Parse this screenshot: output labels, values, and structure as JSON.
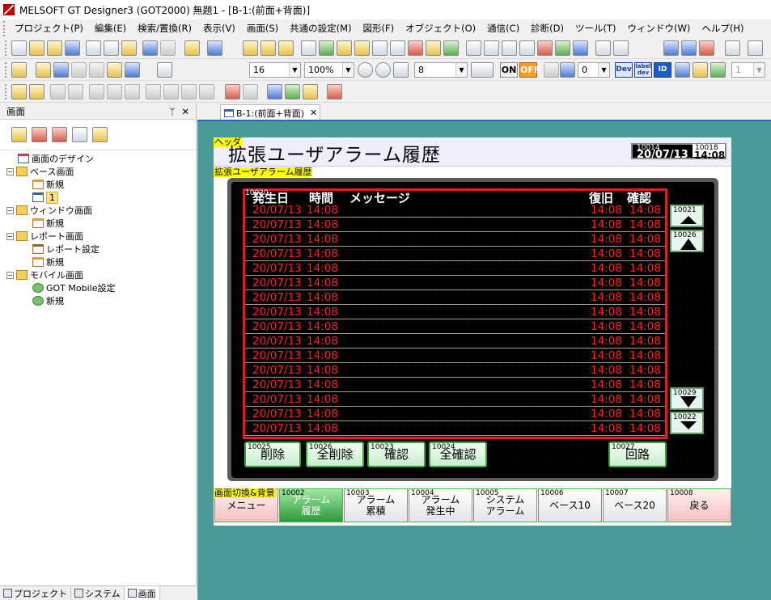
{
  "window": {
    "title": "MELSOFT GT Designer3 (GOT2000) 無題1 - [B-1:(前面+背面)]"
  },
  "menu": [
    "プロジェクト(P)",
    "編集(E)",
    "検索/置換(R)",
    "表示(V)",
    "画面(S)",
    "共通の設定(M)",
    "図形(F)",
    "オブジェクト(O)",
    "通信(C)",
    "診断(D)",
    "ツール(T)",
    "ウィンドウ(W)",
    "ヘルプ(H)"
  ],
  "toolbar": {
    "font_size": "16",
    "zoom": "100%",
    "grid": "8",
    "on_label": "ON",
    "off_label": "OFF",
    "step": "0",
    "dev_label": "Dev",
    "label_dev": "label dev",
    "id_label": "ID",
    "layer": "1"
  },
  "left_panel": {
    "title": "画面",
    "pin": "ꟷ",
    "close": "✕",
    "tree": [
      {
        "label": "画面のデザイン",
        "level": 1,
        "icon": "design-icon"
      },
      {
        "label": "ベース画面",
        "level": 0,
        "icon": "folder-icon"
      },
      {
        "label": "新規",
        "level": 1,
        "icon": "new-screen-icon"
      },
      {
        "label": "1",
        "level": 1,
        "icon": "screen-icon",
        "selected": true
      },
      {
        "label": "ウィンドウ画面",
        "level": 0,
        "icon": "folder-icon"
      },
      {
        "label": "新規",
        "level": 1,
        "icon": "new-screen-icon"
      },
      {
        "label": "レポート画面",
        "level": 0,
        "icon": "folder-icon"
      },
      {
        "label": "レポート設定",
        "level": 1,
        "icon": "report-settings-icon"
      },
      {
        "label": "新規",
        "level": 1,
        "icon": "new-screen-icon"
      },
      {
        "label": "モバイル画面",
        "level": 0,
        "icon": "folder-icon"
      },
      {
        "label": "GOT Mobile設定",
        "level": 1,
        "icon": "mobile-settings-icon"
      },
      {
        "label": "新規",
        "level": 1,
        "icon": "new-screen-icon"
      }
    ]
  },
  "bottom_tabs": [
    "プロジェクト",
    "システム",
    "画面"
  ],
  "doc_tab": {
    "label": "B-1:(前面+背面)",
    "close": "✕"
  },
  "screen": {
    "header_tag": "ヘッダ",
    "title": "拡張ユーザアラーム履歴",
    "alarm_tag": "拡張ユーザアラーム履歴",
    "nav_tag": "画面切換&背景",
    "clock": {
      "dev1": "10014",
      "date": "20/07/13",
      "dev2": "10018",
      "time": "14:08"
    },
    "alarm": {
      "dev": "10020",
      "columns": [
        "発生日",
        "時間",
        "メッセージ",
        "復旧",
        "確認"
      ],
      "rows": [
        [
          "20/07/13",
          "14:08",
          "14:08",
          "14:08"
        ],
        [
          "20/07/13",
          "14:08",
          "14:08",
          "14:08"
        ],
        [
          "20/07/13",
          "14:08",
          "14:08",
          "14:08"
        ],
        [
          "20/07/13",
          "14:08",
          "14:08",
          "14:08"
        ],
        [
          "20/07/13",
          "14:08",
          "14:08",
          "14:08"
        ],
        [
          "20/07/13",
          "14:08",
          "14:08",
          "14:08"
        ],
        [
          "20/07/13",
          "14:08",
          "14:08",
          "14:08"
        ],
        [
          "20/07/13",
          "14:08",
          "14:08",
          "14:08"
        ],
        [
          "20/07/13",
          "14:08",
          "14:08",
          "14:08"
        ],
        [
          "20/07/13",
          "14:08",
          "14:08",
          "14:08"
        ],
        [
          "20/07/13",
          "14:08",
          "14:08",
          "14:08"
        ],
        [
          "20/07/13",
          "14:08",
          "14:08",
          "14:08"
        ],
        [
          "20/07/13",
          "14:08",
          "14:08",
          "14:08"
        ],
        [
          "20/07/13",
          "14:08",
          "14:08",
          "14:08"
        ],
        [
          "20/07/13",
          "14:08",
          "14:08",
          "14:08"
        ],
        [
          "20/07/13",
          "14:08",
          "14:08",
          "14:08"
        ]
      ]
    },
    "side": [
      {
        "dev": "10021",
        "icon": "scroll-top-icon"
      },
      {
        "dev": "10026",
        "icon": "scroll-up-icon"
      },
      {
        "dev": "10029",
        "icon": "scroll-down-icon"
      },
      {
        "dev": "10022",
        "icon": "scroll-bottom-icon"
      }
    ],
    "buttons": [
      {
        "dev": "10025",
        "label": "削除"
      },
      {
        "dev": "10026",
        "label": "全削除"
      },
      {
        "dev": "10023",
        "label": "確認"
      },
      {
        "dev": "10024",
        "label": "全確認"
      },
      {
        "dev": "10027",
        "label": "回路"
      }
    ],
    "nav": [
      {
        "dev": "",
        "label": "メニュー"
      },
      {
        "dev": "10002",
        "label": "アラーム\n履歴"
      },
      {
        "dev": "10003",
        "label": "アラーム\n累積"
      },
      {
        "dev": "10004",
        "label": "アラーム\n発生中"
      },
      {
        "dev": "10005",
        "label": "システム\nアラーム"
      },
      {
        "dev": "10006",
        "label": "ベース10"
      },
      {
        "dev": "10007",
        "label": "ベース20"
      },
      {
        "dev": "10008",
        "label": "戻る"
      }
    ]
  },
  "colors": {
    "alarm_text": "#ff2020",
    "frame": "#e02020",
    "workspace": "#4a9a9a",
    "nav_active": "#2c9a3c"
  }
}
